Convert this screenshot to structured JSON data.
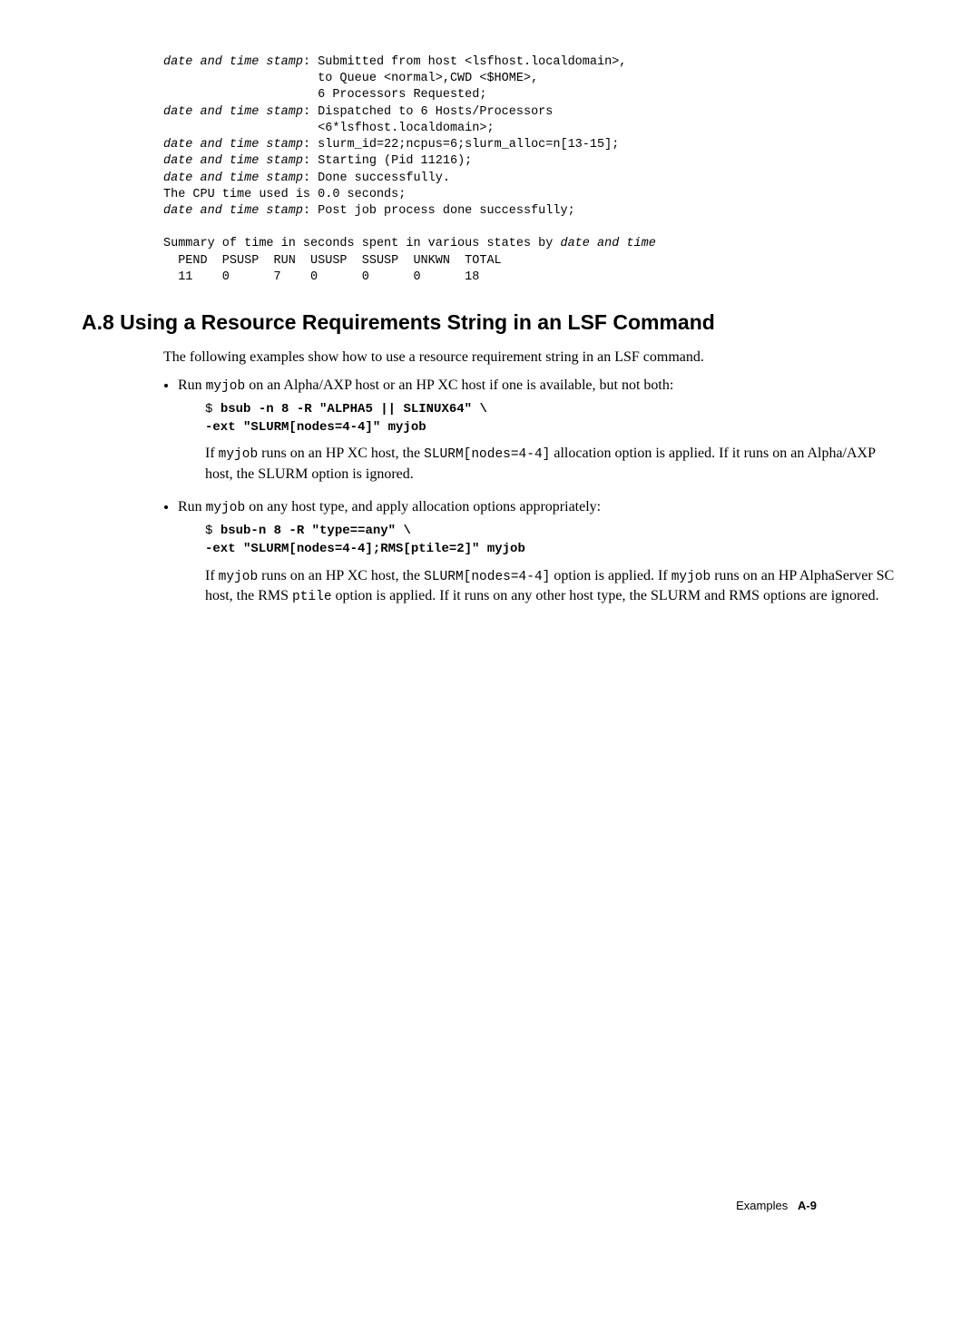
{
  "codeblock": {
    "l1a": "date and time stamp",
    "l1b": ": Submitted from host <lsfhost.localdomain>,",
    "l2": "                     to Queue <normal>,CWD <$HOME>,",
    "l3": "                     6 Processors Requested;",
    "l4a": "date and time stamp",
    "l4b": ": Dispatched to 6 Hosts/Processors",
    "l5": "                     <6*lsfhost.localdomain>;",
    "l6a": "date and time stamp",
    "l6b": ": slurm_id=22;ncpus=6;slurm_alloc=n[13-15];",
    "l7a": "date and time stamp",
    "l7b": ": Starting (Pid 11216);",
    "l8a": "date and time stamp",
    "l8b": ": Done successfully.",
    "l9": "The CPU time used is 0.0 seconds;",
    "l10a": "date and time stamp",
    "l10b": ": Post job process done successfully;",
    "l11a": "Summary of time in seconds spent in various states by ",
    "l11b": "date and time",
    "l12": "  PEND  PSUSP  RUN  USUSP  SSUSP  UNKWN  TOTAL",
    "l13": "  11    0      7    0      0      0      18"
  },
  "heading": "A.8  Using a Resource Requirements String in an LSF Command",
  "intro": "The following examples show how to use a resource requirement string in an LSF command.",
  "bullet1": {
    "preText": "Run ",
    "code1": "myjob",
    "midText": " on an Alpha/AXP host or an HP XC host if one is available, but not both:",
    "cmd_dollar": "$ ",
    "cmd_line1": "bsub -n 8 -R \"ALPHA5 || SLINUX64\" \\",
    "cmd_line2": "-ext \"SLURM[nodes=4-4]\" myjob",
    "para_p1": "If ",
    "para_c1": "myjob",
    "para_p2": " runs on an HP XC host, the ",
    "para_c2": "SLURM[nodes=4-4]",
    "para_p3": " allocation option is applied. If it runs on an Alpha/AXP host, the SLURM option is ignored."
  },
  "bullet2": {
    "preText": "Run ",
    "code1": "myjob",
    "midText": " on any host type, and apply allocation options appropriately:",
    "cmd_dollar": "$ ",
    "cmd_line1": "bsub-n 8 -R \"type==any\" \\",
    "cmd_line2": "-ext \"SLURM[nodes=4-4];RMS[ptile=2]\" myjob",
    "para_p1": "If ",
    "para_c1": "myjob",
    "para_p2": " runs on an HP XC host, the ",
    "para_c2": "SLURM[nodes=4-4]",
    "para_p3": " option is applied. If ",
    "para_c3": "myjob",
    "para_p4": " runs on an HP AlphaServer SC host, the RMS ",
    "para_c4": "ptile",
    "para_p5": " option is applied. If it runs on any other host type, the SLURM and RMS options are ignored."
  },
  "footer": {
    "label": "Examples",
    "page": "A-9"
  }
}
